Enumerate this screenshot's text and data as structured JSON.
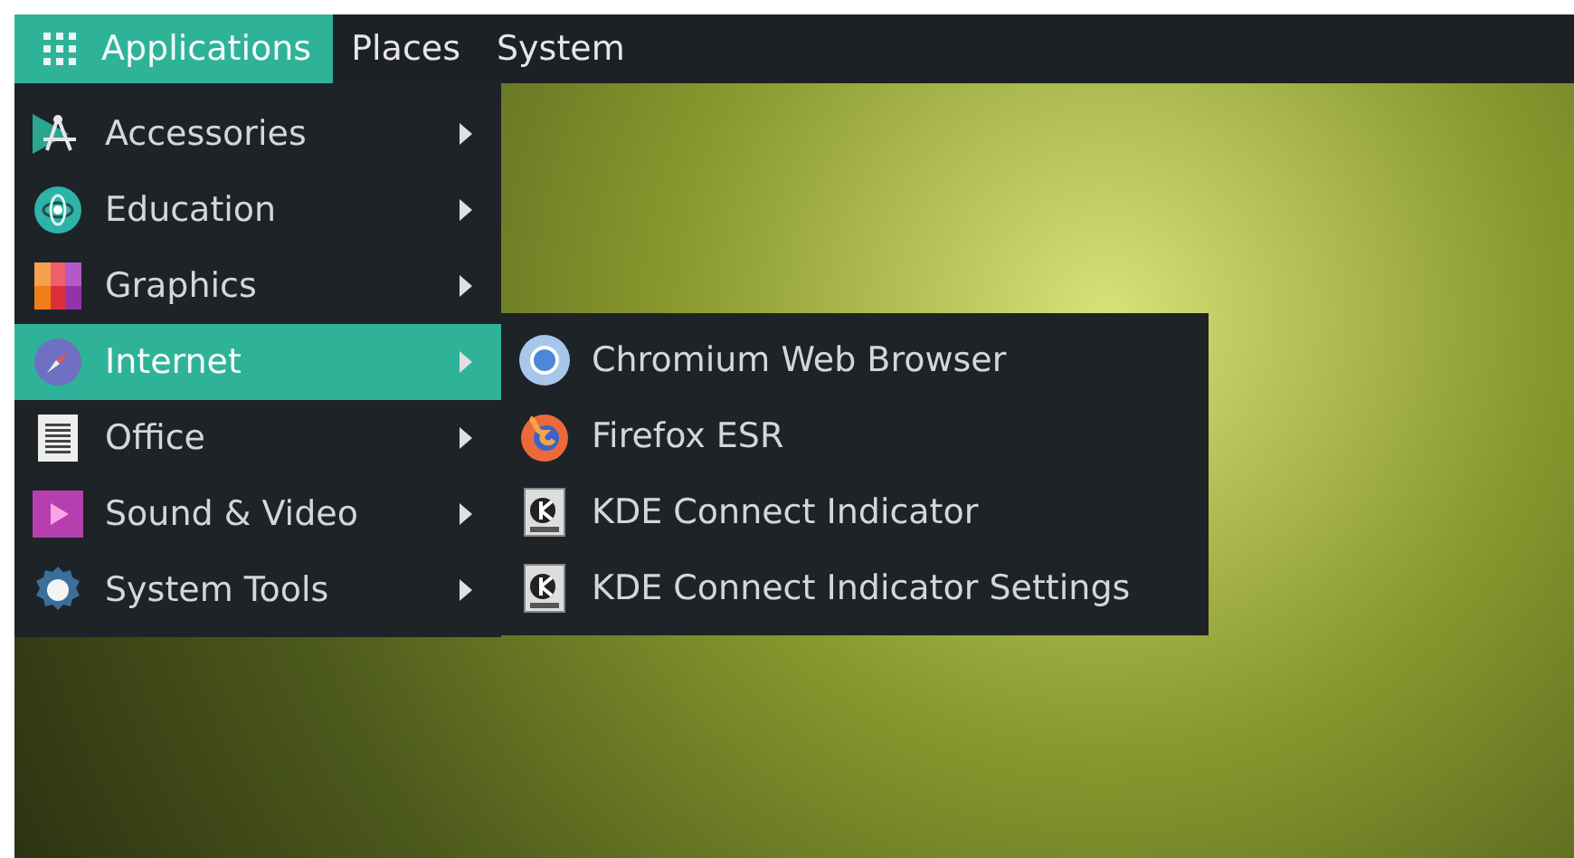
{
  "menubar": [
    {
      "label": "Applications",
      "selected": true
    },
    {
      "label": "Places",
      "selected": false
    },
    {
      "label": "System",
      "selected": false
    }
  ],
  "categories": [
    {
      "label": "Accessories",
      "selected": false
    },
    {
      "label": "Education",
      "selected": false
    },
    {
      "label": "Graphics",
      "selected": false
    },
    {
      "label": "Internet",
      "selected": true,
      "submenu": [
        {
          "label": "Chromium Web Browser"
        },
        {
          "label": "Firefox ESR"
        },
        {
          "label": "KDE Connect Indicator"
        },
        {
          "label": "KDE Connect Indicator Settings"
        }
      ]
    },
    {
      "label": "Office",
      "selected": false
    },
    {
      "label": "Sound & Video",
      "selected": false
    },
    {
      "label": "System Tools",
      "selected": false
    }
  ]
}
